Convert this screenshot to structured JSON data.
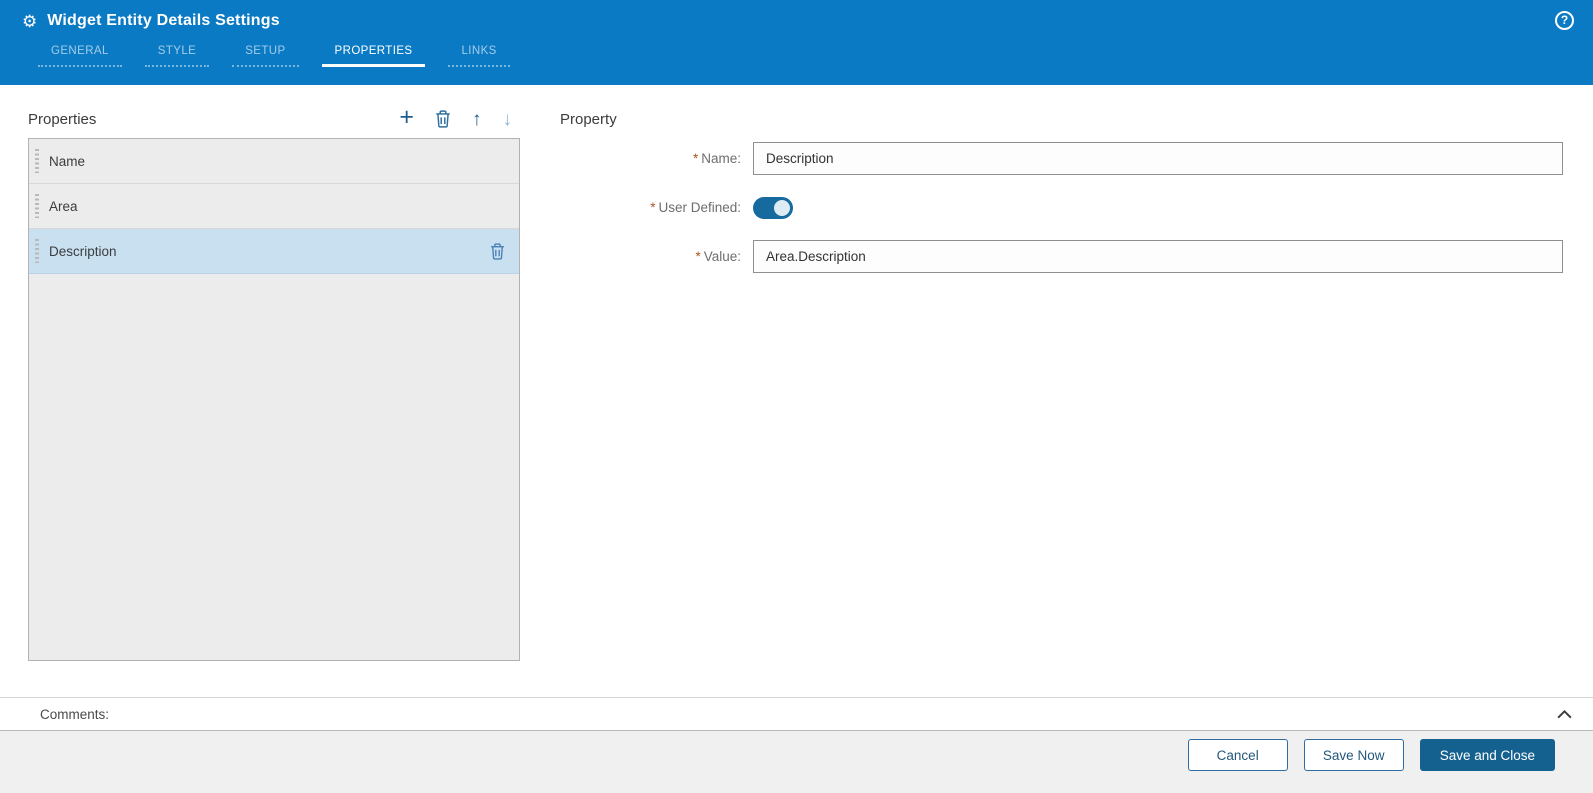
{
  "header": {
    "title": "Widget Entity Details Settings",
    "tabs": [
      {
        "label": "GENERAL",
        "active": false
      },
      {
        "label": "STYLE",
        "active": false
      },
      {
        "label": "SETUP",
        "active": false
      },
      {
        "label": "PROPERTIES",
        "active": true
      },
      {
        "label": "LINKS",
        "active": false
      }
    ]
  },
  "icons": {
    "gear": "⚙",
    "help": "?",
    "add": "+",
    "move_up": "↑",
    "move_down": "↓",
    "delete": "trash-icon",
    "drag": "drag-handle-icon",
    "collapse": "chevron-up-icon"
  },
  "properties_panel": {
    "title": "Properties",
    "items": [
      {
        "label": "Name",
        "selected": false
      },
      {
        "label": "Area",
        "selected": false
      },
      {
        "label": "Description",
        "selected": true
      }
    ]
  },
  "property_form": {
    "title": "Property",
    "fields": {
      "name": {
        "label": "Name:",
        "required": "*",
        "value": "Description"
      },
      "user_defined": {
        "label": "User Defined:",
        "required": "*",
        "value": "on"
      },
      "value": {
        "label": "Value:",
        "required": "*",
        "value": "Area.Description"
      }
    }
  },
  "comments": {
    "label": "Comments:"
  },
  "footer": {
    "buttons": [
      {
        "label": "Cancel",
        "style": "outline"
      },
      {
        "label": "Save Now",
        "style": "outline"
      },
      {
        "label": "Save and Close",
        "style": "primary"
      }
    ]
  },
  "colors": {
    "header_blue": "#0b7ac4",
    "selected_row": "#c9e0f1",
    "primary_button": "#14608f",
    "toggle_on": "#176a9e",
    "required_asterisk": "#a8581f",
    "toolbar_icon": "#1e5d8d",
    "disabled_icon": "#8fb5d6"
  }
}
